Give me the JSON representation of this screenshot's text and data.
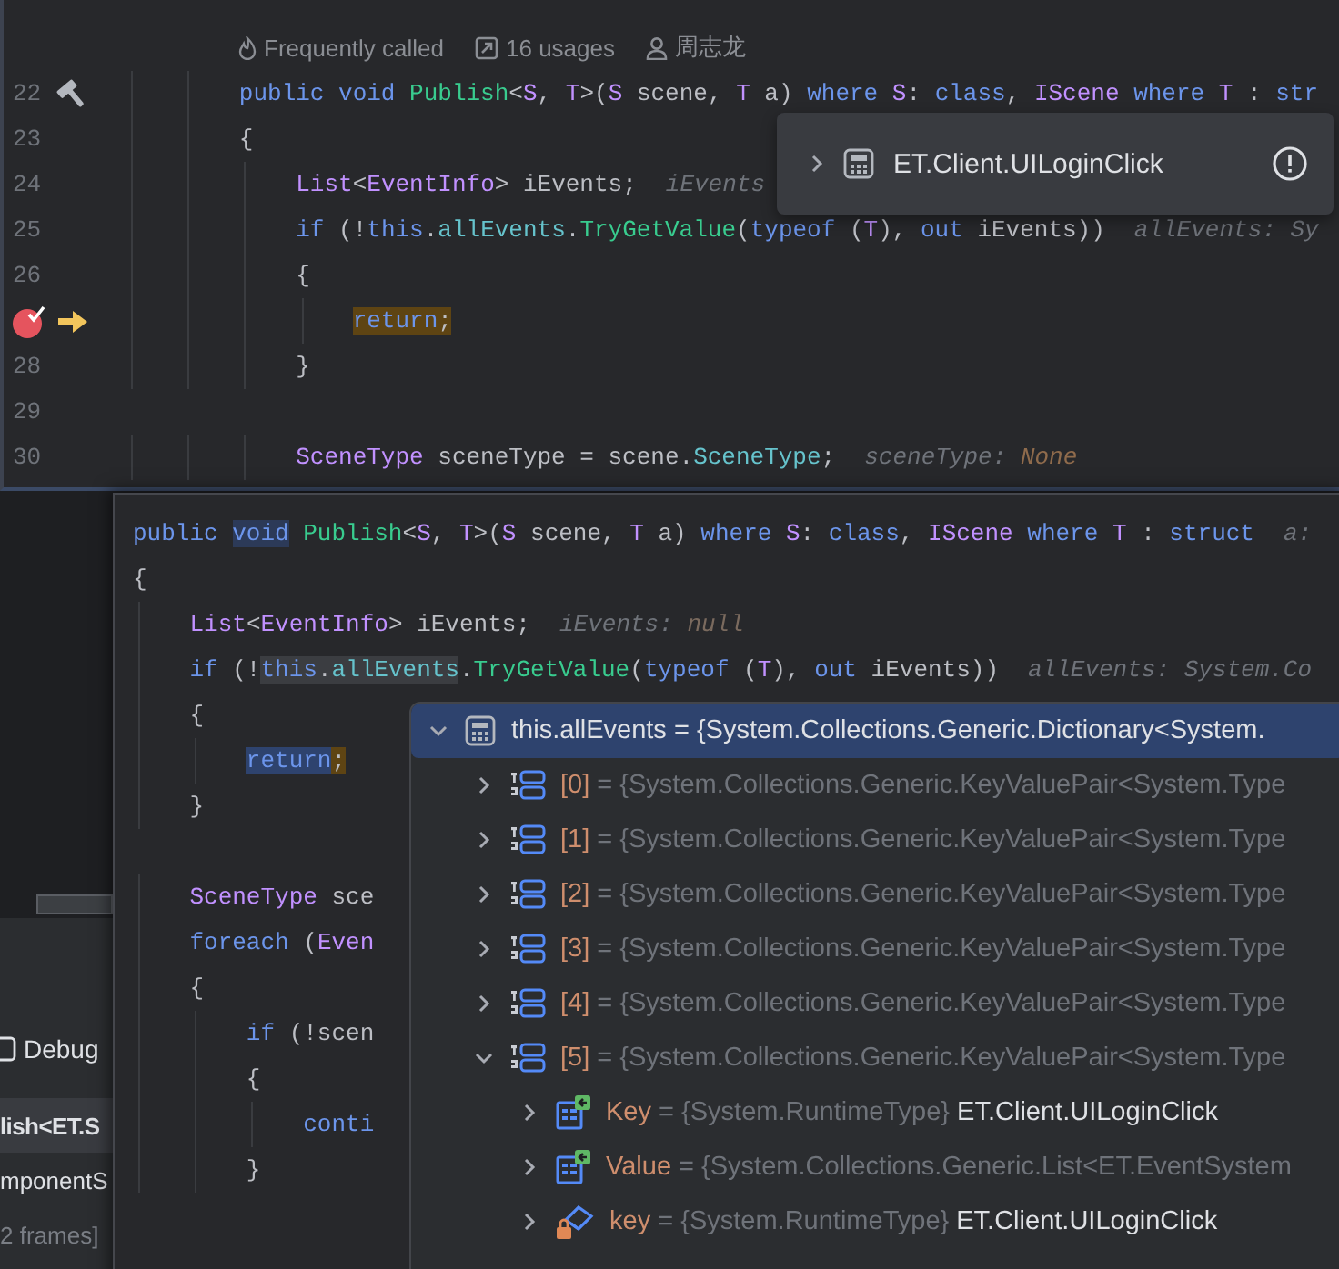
{
  "top_editor": {
    "lines": [
      {
        "kind": "code"
      },
      {
        "kind": "inlay",
        "hints": [
          {
            "kind": "frequency",
            "text": "Frequently called"
          },
          {
            "kind": "usages",
            "text": "16 usages"
          },
          {
            "kind": "author",
            "text": "周志龙"
          }
        ]
      },
      {
        "kind": "code",
        "number": "22",
        "markers": [
          {
            "kind": "hammer"
          }
        ],
        "code": [
          {
            "text": "        public void",
            "kind": "kw"
          },
          {
            "text": " Publish",
            "kind": "method"
          },
          {
            "text": "<",
            "kind": "plain"
          },
          {
            "text": "S",
            "kind": "type"
          },
          {
            "text": ", ",
            "kind": "plain"
          },
          {
            "text": "T",
            "kind": "type"
          },
          {
            "text": ">(",
            "kind": "plain"
          },
          {
            "text": "S",
            "kind": "type"
          },
          {
            "text": " scene, ",
            "kind": "plain"
          },
          {
            "text": "T",
            "kind": "type"
          },
          {
            "text": " a) ",
            "kind": "plain"
          },
          {
            "text": "where",
            "kind": "kw"
          },
          {
            "text": " S",
            "kind": "type"
          },
          {
            "text": ": ",
            "kind": "plain"
          },
          {
            "text": "class",
            "kind": "kw"
          },
          {
            "text": ", ",
            "kind": "plain"
          },
          {
            "text": "IScene",
            "kind": "type"
          },
          {
            "text": " where",
            "kind": "kw"
          },
          {
            "text": " T",
            "kind": "type"
          },
          {
            "text": " : ",
            "kind": "plain"
          },
          {
            "text": "str",
            "kind": "kw"
          }
        ]
      },
      {
        "kind": "code",
        "number": "23",
        "code": [
          {
            "text": "        {",
            "kind": "plain"
          }
        ]
      },
      {
        "kind": "code",
        "number": "24",
        "code": [
          {
            "text": "            List",
            "kind": "type"
          },
          {
            "text": "<",
            "kind": "plain"
          },
          {
            "text": "EventInfo",
            "kind": "type"
          },
          {
            "text": "> iEvents;",
            "kind": "plain"
          }
        ],
        "hint": [
          {
            "text": "iEvents",
            "kind": "hint"
          }
        ]
      },
      {
        "kind": "code",
        "number": "25",
        "code": [
          {
            "text": "            if",
            "kind": "kw"
          },
          {
            "text": " (!",
            "kind": "plain"
          },
          {
            "text": "this",
            "kind": "kw"
          },
          {
            "text": ".",
            "kind": "plain"
          },
          {
            "text": "allEvents",
            "kind": "field"
          },
          {
            "text": ".",
            "kind": "plain"
          },
          {
            "text": "TryGetValue",
            "kind": "method"
          },
          {
            "text": "(",
            "kind": "plain"
          },
          {
            "text": "typeof",
            "kind": "kw"
          },
          {
            "text": " (",
            "kind": "plain"
          },
          {
            "text": "T",
            "kind": "type"
          },
          {
            "text": "), ",
            "kind": "plain"
          },
          {
            "text": "out",
            "kind": "kw"
          },
          {
            "text": " iEvents))",
            "kind": "plain"
          }
        ],
        "hint": [
          {
            "text": "allEvents: Sy",
            "kind": "hint"
          }
        ]
      },
      {
        "kind": "code",
        "number": "26",
        "code": [
          {
            "text": "            {",
            "kind": "plain"
          }
        ]
      },
      {
        "kind": "code",
        "markers": [
          {
            "kind": "breakpoint"
          },
          {
            "kind": "execution"
          }
        ],
        "code": [
          {
            "text": "                return",
            "kind": "kw",
            "execution_point": true
          },
          {
            "text": ";",
            "kind": "plain",
            "execution_point": true
          }
        ]
      },
      {
        "kind": "code",
        "number": "28",
        "code": [
          {
            "text": "            }",
            "kind": "plain"
          }
        ]
      },
      {
        "kind": "code",
        "number": "29"
      },
      {
        "kind": "code",
        "number": "30",
        "code": [
          {
            "text": "            SceneType",
            "kind": "type"
          },
          {
            "text": " sceneType = scene.",
            "kind": "plain"
          },
          {
            "text": "SceneType",
            "kind": "field"
          },
          {
            "text": ";",
            "kind": "plain"
          }
        ],
        "hint": [
          {
            "text": "sceneType: ",
            "kind": "hint"
          },
          {
            "text": "None",
            "kind": "hint_value"
          }
        ]
      }
    ]
  },
  "value_popup": {
    "kind": "dictionary",
    "expanded": false,
    "label": "ET.Client.UILoginClick"
  },
  "tool_window": {
    "tab": "Debug",
    "frames": [
      {
        "text": "lish<ET.S",
        "kind": "frame",
        "selected": true
      },
      {
        "text": "mponentS",
        "kind": "frame",
        "selected": false
      },
      {
        "text": "2 frames]",
        "kind": "hidden",
        "selected": false
      }
    ]
  },
  "definition_popup": {
    "lines": [
      {
        "kind": "code",
        "code": [
          {
            "text": "public ",
            "kind": "kw"
          },
          {
            "text": "void",
            "kind": "kw",
            "usage": true
          },
          {
            "text": " Publish",
            "kind": "method"
          },
          {
            "text": "<",
            "kind": "plain"
          },
          {
            "text": "S",
            "kind": "type"
          },
          {
            "text": ", ",
            "kind": "plain"
          },
          {
            "text": "T",
            "kind": "type"
          },
          {
            "text": ">(",
            "kind": "plain"
          },
          {
            "text": "S",
            "kind": "type"
          },
          {
            "text": " scene, ",
            "kind": "plain"
          },
          {
            "text": "T",
            "kind": "type"
          },
          {
            "text": " a) ",
            "kind": "plain"
          },
          {
            "text": "where",
            "kind": "kw"
          },
          {
            "text": " S",
            "kind": "type"
          },
          {
            "text": ": ",
            "kind": "plain"
          },
          {
            "text": "class",
            "kind": "kw"
          },
          {
            "text": ", ",
            "kind": "plain"
          },
          {
            "text": "IScene",
            "kind": "type"
          },
          {
            "text": " where",
            "kind": "kw"
          },
          {
            "text": " T",
            "kind": "type"
          },
          {
            "text": " : ",
            "kind": "plain"
          },
          {
            "text": "struct",
            "kind": "kw"
          }
        ],
        "hint": [
          {
            "text": "a:",
            "kind": "hint"
          }
        ]
      },
      {
        "kind": "code",
        "code": [
          {
            "text": "{",
            "kind": "plain"
          }
        ]
      },
      {
        "kind": "code",
        "code": [
          {
            "text": "    List",
            "kind": "type"
          },
          {
            "text": "<",
            "kind": "plain"
          },
          {
            "text": "EventInfo",
            "kind": "type"
          },
          {
            "text": "> iEvents;",
            "kind": "plain"
          }
        ],
        "hint": [
          {
            "text": "iEvents: ",
            "kind": "hint"
          },
          {
            "text": "null",
            "kind": "hint_null"
          }
        ]
      },
      {
        "kind": "code",
        "code": [
          {
            "text": "    if",
            "kind": "kw"
          },
          {
            "text": " (!",
            "kind": "plain"
          },
          {
            "text": "this",
            "kind": "kw",
            "read": true
          },
          {
            "text": ".",
            "kind": "plain",
            "read": true
          },
          {
            "text": "allEvents",
            "kind": "field",
            "read": true
          },
          {
            "text": ".",
            "kind": "plain"
          },
          {
            "text": "TryGetValue",
            "kind": "method"
          },
          {
            "text": "(",
            "kind": "plain"
          },
          {
            "text": "typeof",
            "kind": "kw"
          },
          {
            "text": " (",
            "kind": "plain"
          },
          {
            "text": "T",
            "kind": "type"
          },
          {
            "text": "), ",
            "kind": "plain"
          },
          {
            "text": "out",
            "kind": "kw"
          },
          {
            "text": " iEvents))",
            "kind": "plain"
          }
        ],
        "hint": [
          {
            "text": "allEvents: System.Co",
            "kind": "hint"
          }
        ]
      },
      {
        "kind": "code",
        "code": [
          {
            "text": "    {",
            "kind": "plain"
          }
        ]
      },
      {
        "kind": "code",
        "code": [
          {
            "text": "        return",
            "kind": "kw",
            "selected": true
          },
          {
            "text": ";",
            "kind": "plain",
            "execution_point": true
          }
        ]
      },
      {
        "kind": "code",
        "code": [
          {
            "text": "    }",
            "kind": "plain"
          }
        ]
      },
      {
        "kind": "code"
      },
      {
        "kind": "code",
        "code": [
          {
            "text": "    SceneType",
            "kind": "type"
          },
          {
            "text": " sce",
            "kind": "plain"
          }
        ]
      },
      {
        "kind": "code",
        "code": [
          {
            "text": "    foreach",
            "kind": "kw"
          },
          {
            "text": " (",
            "kind": "plain"
          },
          {
            "text": "Even",
            "kind": "type"
          }
        ]
      },
      {
        "kind": "code",
        "code": [
          {
            "text": "    {",
            "kind": "plain"
          }
        ]
      },
      {
        "kind": "code",
        "code": [
          {
            "text": "        if",
            "kind": "kw"
          },
          {
            "text": " (!scen",
            "kind": "plain"
          }
        ]
      },
      {
        "kind": "code",
        "code": [
          {
            "text": "        {",
            "kind": "plain"
          }
        ]
      },
      {
        "kind": "code",
        "code": [
          {
            "text": "            conti",
            "kind": "kw"
          }
        ]
      },
      {
        "kind": "code",
        "code": [
          {
            "text": "        }",
            "kind": "plain"
          }
        ]
      }
    ]
  },
  "debugger_tree": [
    {
      "name": "this.allEvents",
      "eq": "=",
      "type": "{System.Collections.Generic.Dictionary<System.",
      "kind": "dictionary",
      "expanded": true,
      "selected": true,
      "children": [
        {
          "name": "[0]",
          "eq": "=",
          "type": "{System.Collections.Generic.KeyValuePair<System.Type",
          "kind": "list",
          "expanded": false,
          "selected": false
        },
        {
          "name": "[1]",
          "eq": "=",
          "type": "{System.Collections.Generic.KeyValuePair<System.Type",
          "kind": "list",
          "expanded": false,
          "selected": false
        },
        {
          "name": "[2]",
          "eq": "=",
          "type": "{System.Collections.Generic.KeyValuePair<System.Type",
          "kind": "list",
          "expanded": false,
          "selected": false
        },
        {
          "name": "[3]",
          "eq": "=",
          "type": "{System.Collections.Generic.KeyValuePair<System.Type",
          "kind": "list",
          "expanded": false,
          "selected": false
        },
        {
          "name": "[4]",
          "eq": "=",
          "type": "{System.Collections.Generic.KeyValuePair<System.Type",
          "kind": "list",
          "expanded": false,
          "selected": false
        },
        {
          "name": "[5]",
          "eq": "=",
          "type": "{System.Collections.Generic.KeyValuePair<System.Type",
          "kind": "list",
          "expanded": true,
          "selected": false,
          "children": [
            {
              "name": "Key",
              "eq": "=",
              "type": "{System.RuntimeType}",
              "value": "ET.Client.UILoginClick",
              "kind": "property",
              "expanded": false,
              "selected": false
            },
            {
              "name": "Value",
              "eq": "=",
              "type": "{System.Collections.Generic.List<ET.EventSystem",
              "kind": "property",
              "expanded": false,
              "selected": false
            },
            {
              "name": "key",
              "eq": "=",
              "type": "{System.RuntimeType}",
              "value": "ET.Client.UILoginClick",
              "kind": "field",
              "expanded": false,
              "selected": false
            }
          ]
        }
      ]
    }
  ]
}
